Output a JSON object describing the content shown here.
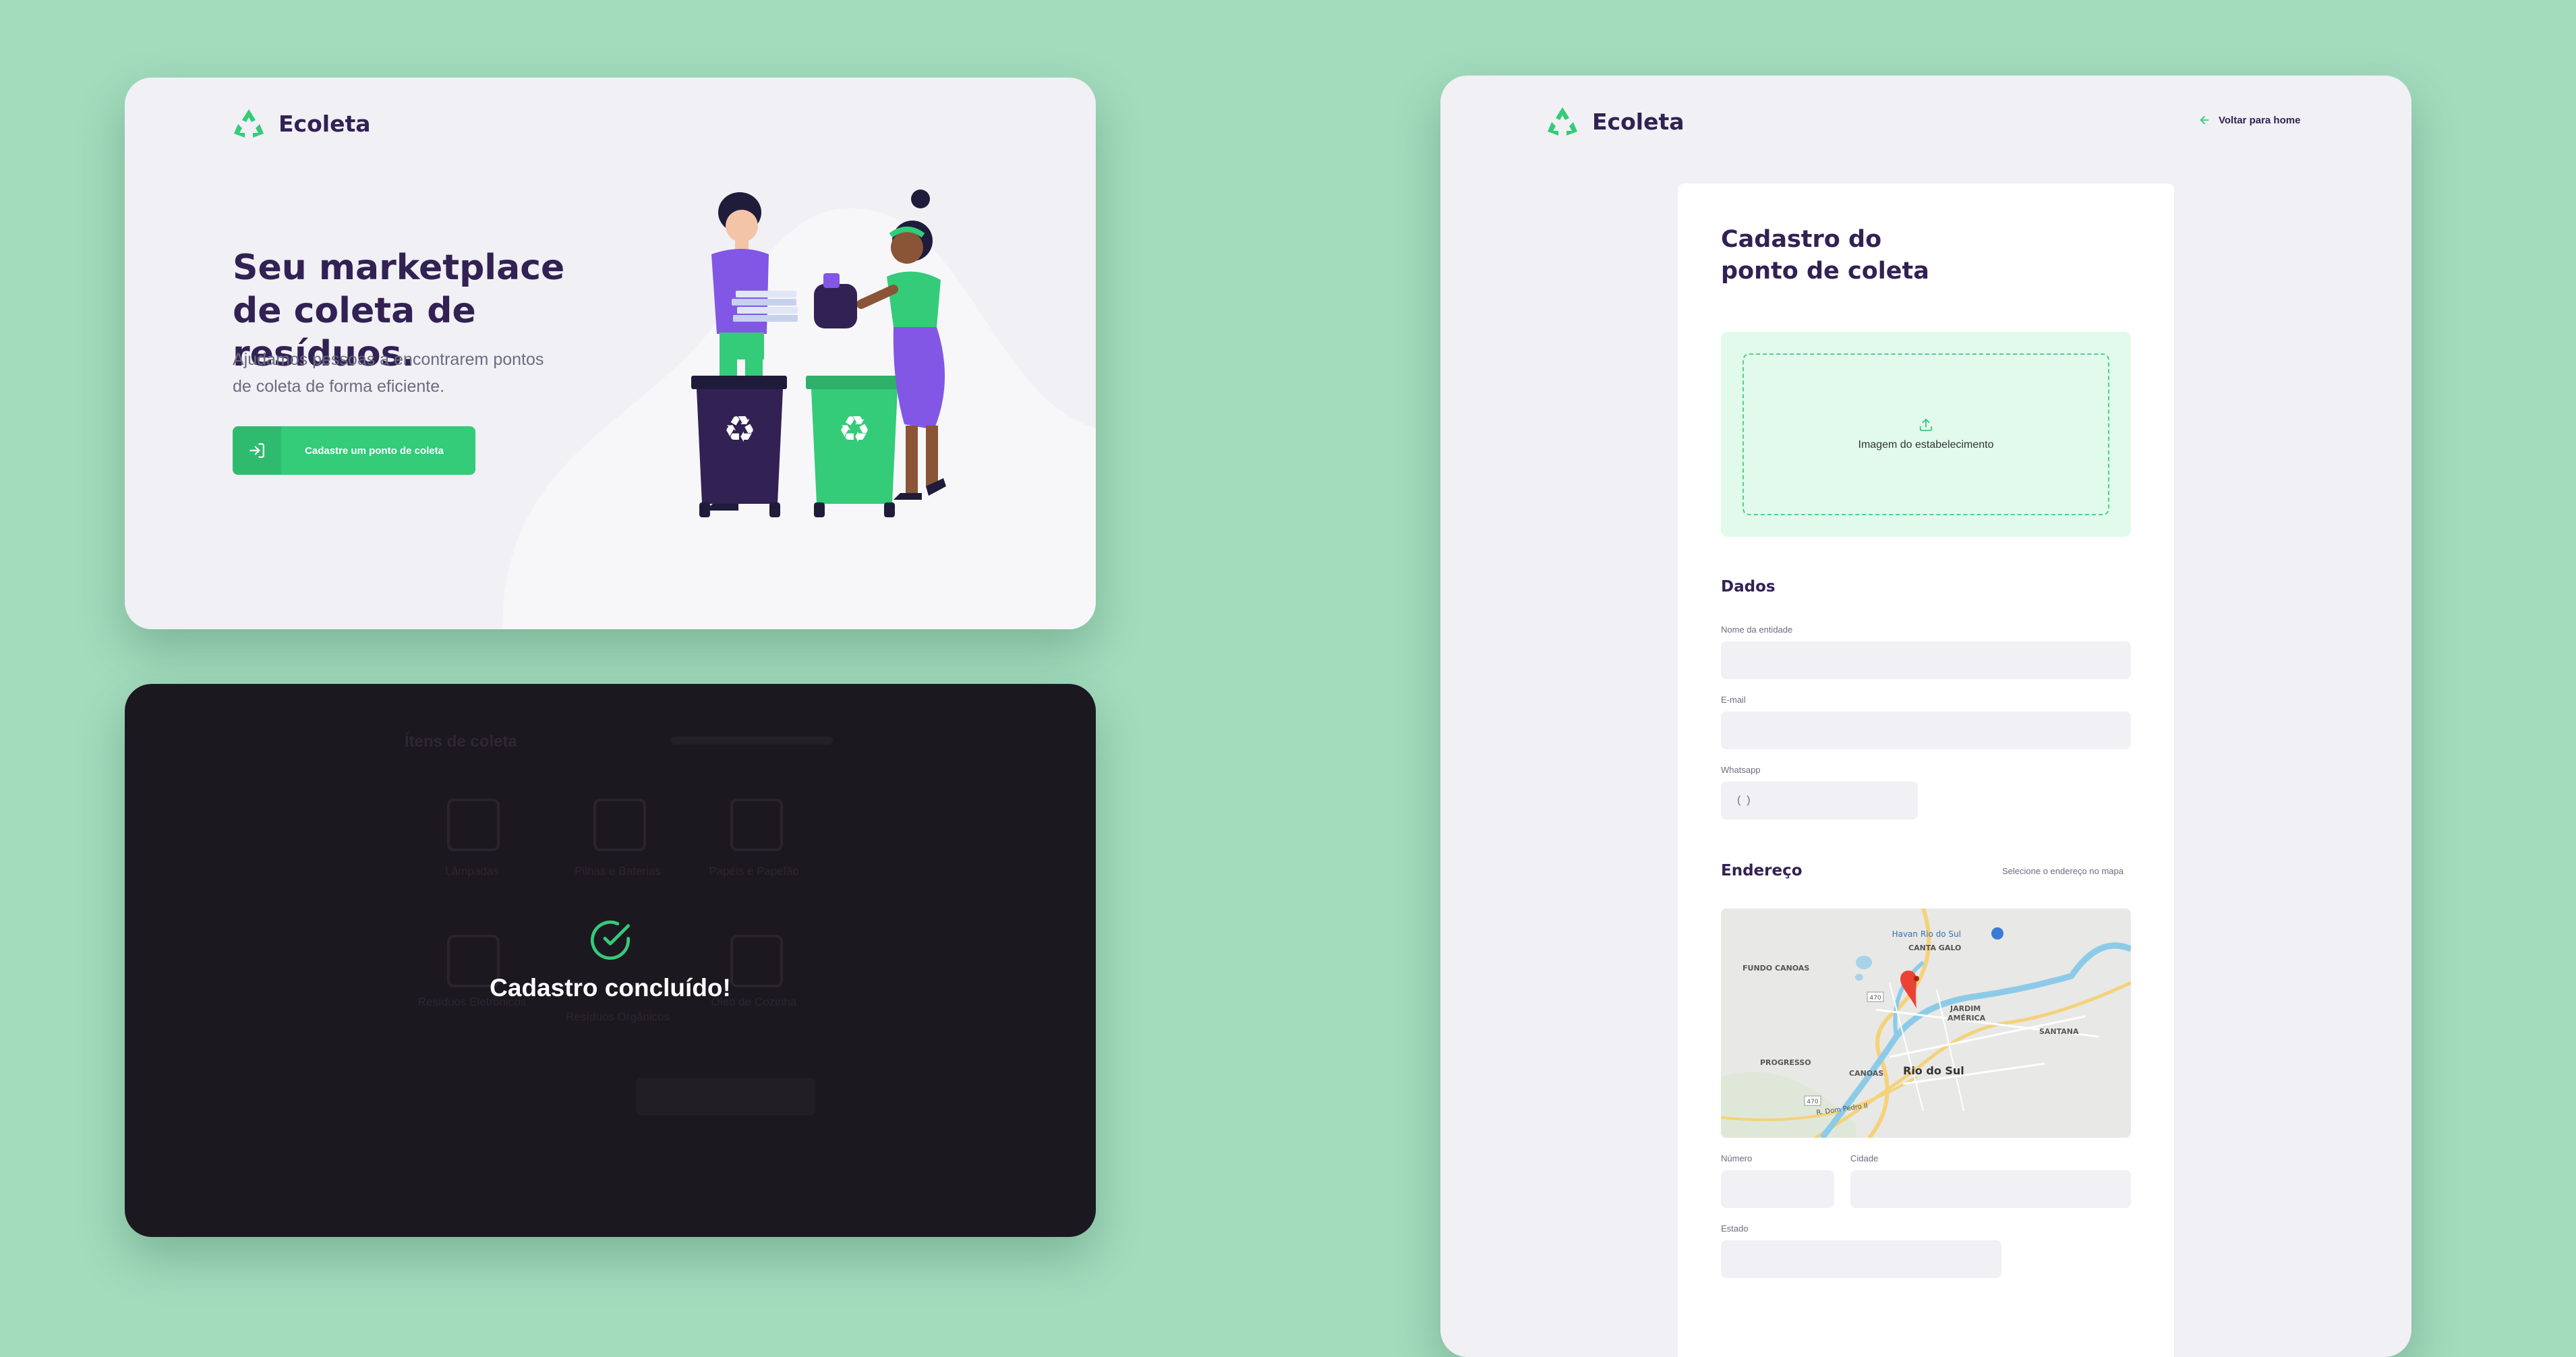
{
  "colors": {
    "background": "#a2dcbd",
    "primary": "#34cb79",
    "title": "#322153",
    "text": "#6c6c80",
    "card": "#f0f0f5",
    "overlay": "#1c1820"
  },
  "home": {
    "brand": "Ecoleta",
    "hero_title_line1": "Seu marketplace",
    "hero_title_line2": "de coleta de resíduos.",
    "hero_sub_line1": "Ajudamos pessoas a encontrarem pontos",
    "hero_sub_line2": "de coleta de forma eficiente.",
    "cta_label": "Cadastre um ponto de coleta",
    "cta_icon": "log-in-icon"
  },
  "success": {
    "message": "Cadastro concluído!",
    "icon": "check-circle-icon",
    "background_title": "Ítens de coleta",
    "background_items": [
      "Lâmpadas",
      "Pilhas e Baterias",
      "Papéis e Papelão",
      "Resíduos Eletrônicos",
      "Resíduos Orgânicos",
      "Óleo de Cozinha"
    ]
  },
  "form": {
    "brand": "Ecoleta",
    "back_link": "Voltar para home",
    "title_line1": "Cadastro do",
    "title_line2": "ponto de coleta",
    "dropzone_label": "Imagem do estabelecimento",
    "dados_legend": "Dados",
    "name_label": "Nome da entidade",
    "email_label": "E-mail",
    "whatsapp_label": "Whatsapp",
    "whatsapp_value": "(  )",
    "endereco_legend": "Endereço",
    "endereco_hint": "Selecione o endereço no mapa",
    "numero_label": "Número",
    "cidade_label": "Cidade",
    "estado_label": "Estado",
    "map_labels": {
      "havan": "Havan Rio do Sul",
      "canta_galo": "CANTA GALO",
      "fundo_canoas": "FUNDO CANOAS",
      "jardim_america_1": "JARDIM",
      "jardim_america_2": "AMÉRICA",
      "santana": "SANTANA",
      "progresso": "PROGRESSO",
      "canoas": "CANOAS",
      "rio_do_sul": "Rio do Sul",
      "road_470a": "470",
      "road_470b": "470",
      "dom_pedro": "R. Dom Pedro II"
    }
  }
}
